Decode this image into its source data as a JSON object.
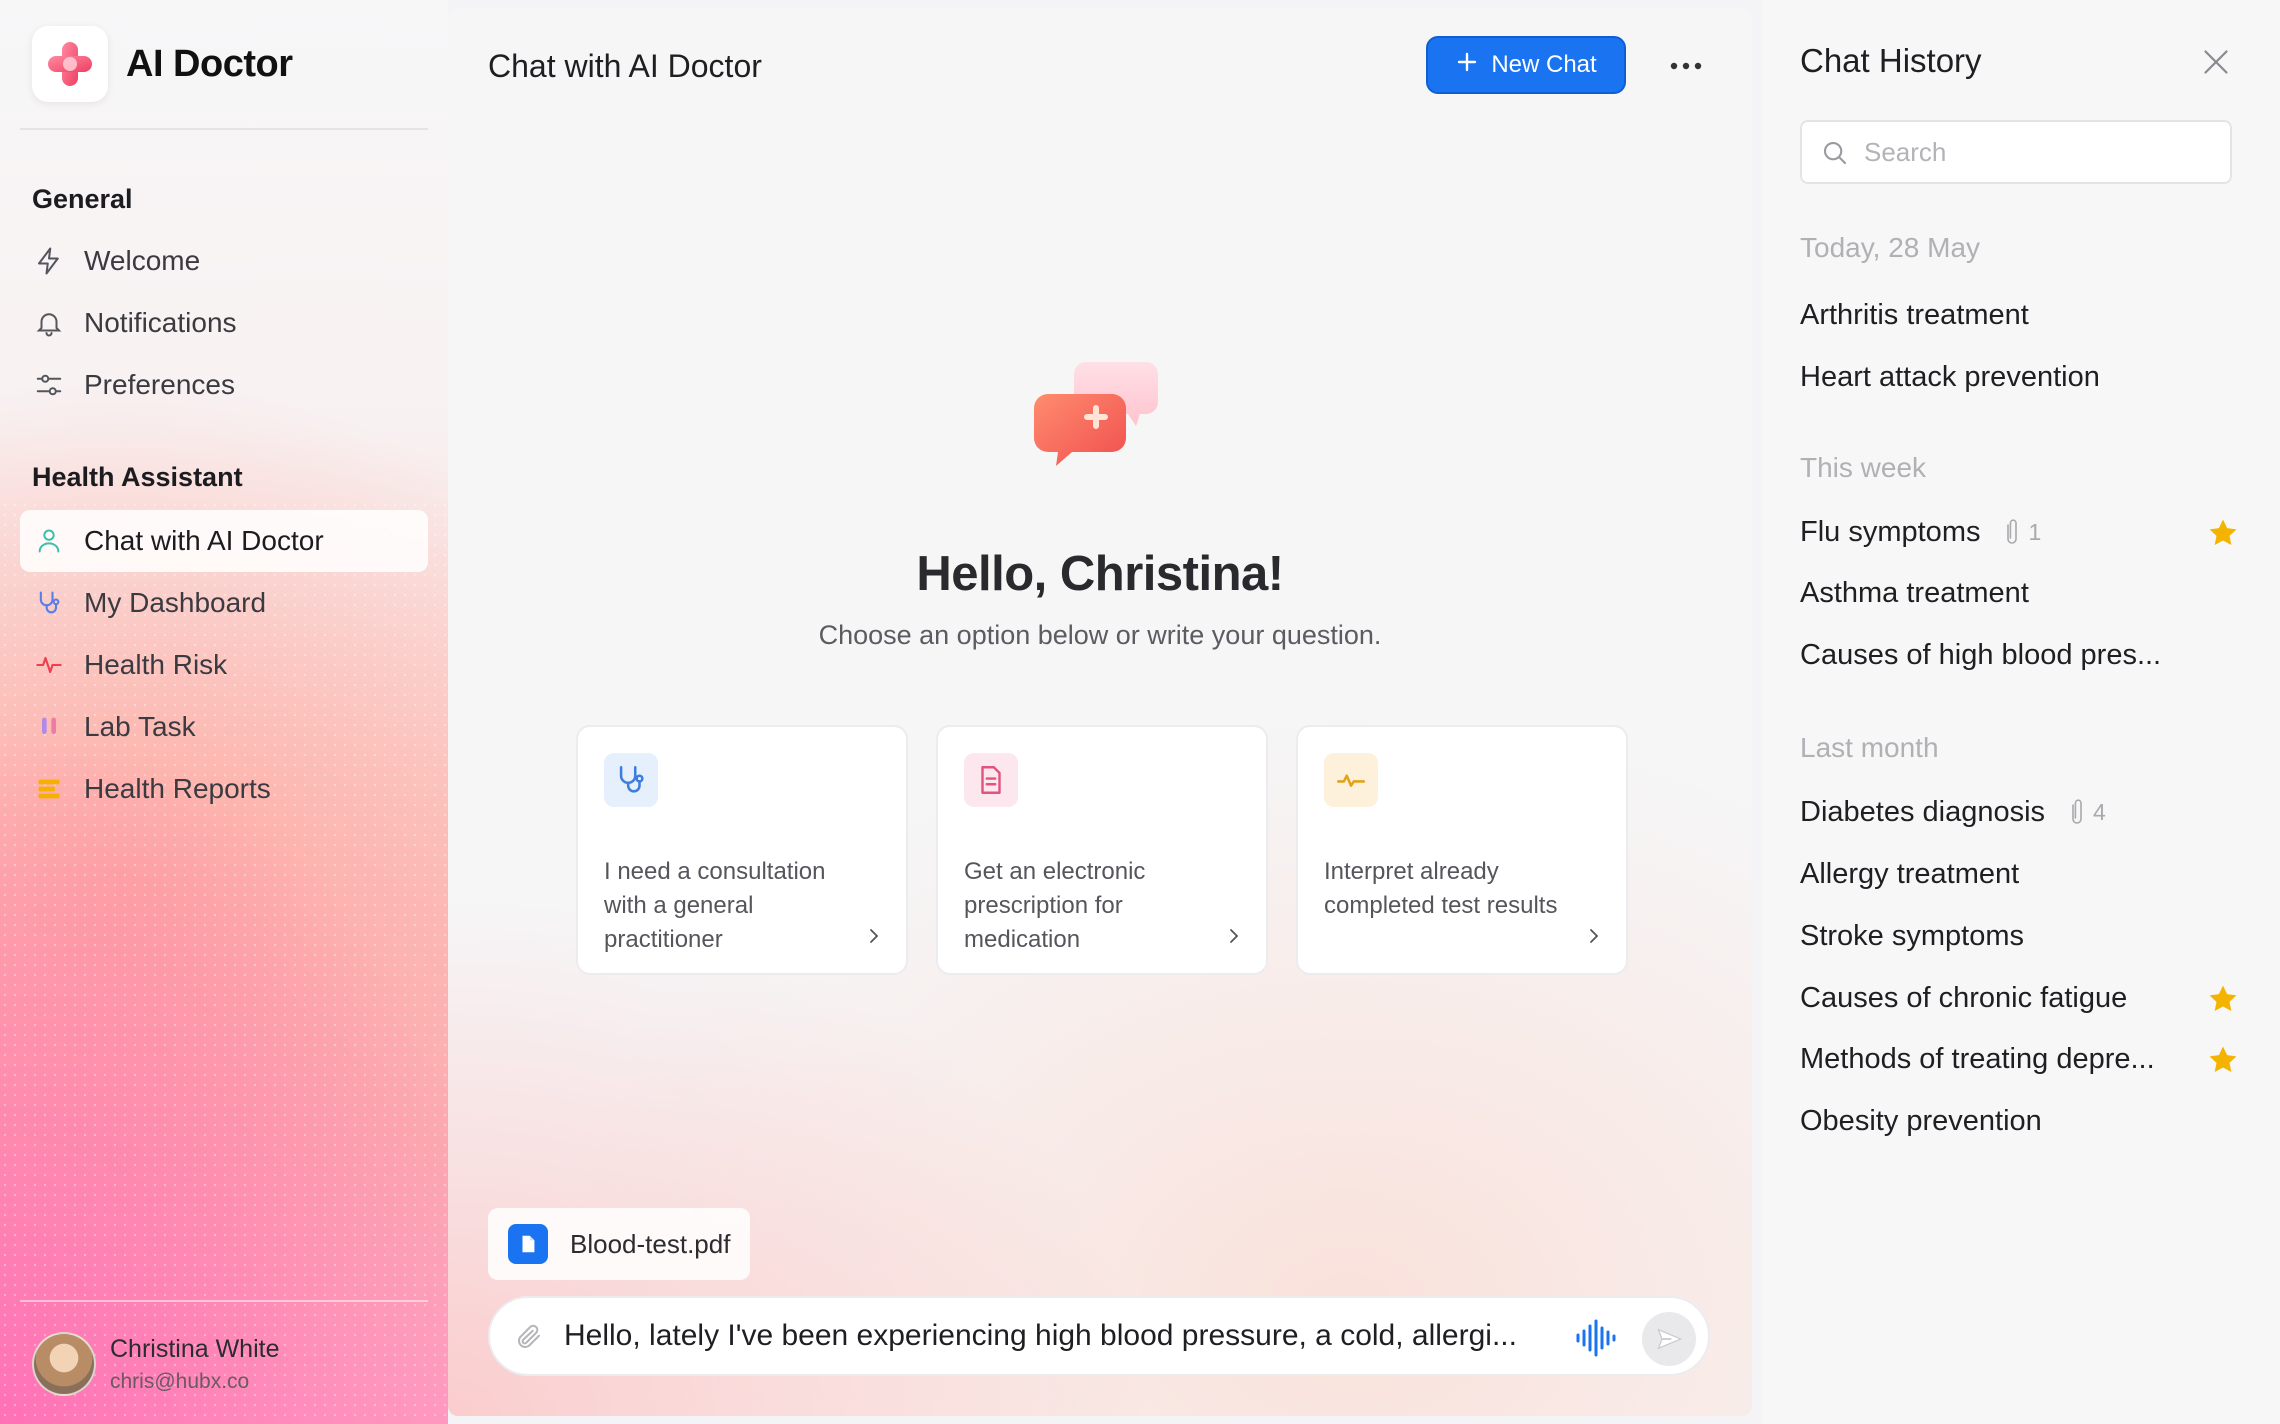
{
  "brand": {
    "name": "AI Doctor"
  },
  "sidebar": {
    "general_title": "General",
    "general_items": [
      {
        "label": "Welcome",
        "icon": "lightning-icon"
      },
      {
        "label": "Notifications",
        "icon": "bell-icon"
      },
      {
        "label": "Preferences",
        "icon": "sliders-icon"
      }
    ],
    "health_title": "Health Assistant",
    "health_items": [
      {
        "label": "Chat with AI Doctor",
        "icon": "doctor-icon",
        "active": true
      },
      {
        "label": "My Dashboard",
        "icon": "stethoscope-icon"
      },
      {
        "label": "Health Risk",
        "icon": "pulse-icon"
      },
      {
        "label": "Lab Task",
        "icon": "test-tubes-icon"
      },
      {
        "label": "Health Reports",
        "icon": "report-icon"
      }
    ]
  },
  "user": {
    "name": "Christina White",
    "email": "chris@hubx.co"
  },
  "main": {
    "title": "Chat with AI Doctor",
    "new_chat_label": "New Chat",
    "greeting": "Hello, Christina!",
    "subtitle": "Choose an option below or write your question.",
    "cards": [
      {
        "text": "I need a consultation with a general practitioner",
        "icon": "stethoscope-icon"
      },
      {
        "text": "Get an electronic prescription for medication",
        "icon": "document-icon"
      },
      {
        "text": "Interpret already completed test results",
        "icon": "pulse-icon"
      }
    ],
    "attachment": {
      "name": "Blood-test.pdf"
    },
    "composer_text": "Hello, lately I've been experiencing high blood pressure, a cold, allergi..."
  },
  "history": {
    "title": "Chat History",
    "search_placeholder": "Search",
    "groups": [
      {
        "label": "Today, 28 May",
        "items": [
          {
            "title": "Arthritis treatment"
          },
          {
            "title": "Heart attack prevention"
          }
        ]
      },
      {
        "label": "This week",
        "items": [
          {
            "title": "Flu symptoms",
            "attachments": "1",
            "starred": true
          },
          {
            "title": "Asthma treatment"
          },
          {
            "title": "Causes of high blood pres..."
          }
        ]
      },
      {
        "label": "Last month",
        "items": [
          {
            "title": "Diabetes diagnosis",
            "attachments": "4"
          },
          {
            "title": "Allergy treatment"
          },
          {
            "title": "Stroke symptoms"
          },
          {
            "title": "Causes of chronic fatigue",
            "starred": true
          },
          {
            "title": "Methods of treating depre...",
            "starred": true
          },
          {
            "title": "Obesity prevention"
          }
        ]
      }
    ]
  },
  "colors": {
    "accent": "#1a73f0",
    "star": "#f5b301",
    "brand_logo": "#f0506e"
  }
}
